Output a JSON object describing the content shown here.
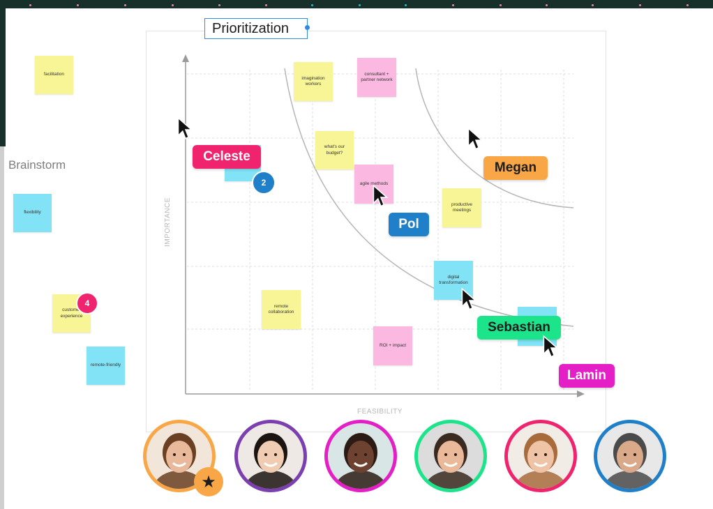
{
  "frame": {
    "title": "Prioritization"
  },
  "sidebar": {
    "label": "Brainstorm"
  },
  "axes": {
    "x_label": "FEASIBILITY",
    "y_label": "IMPORTANCE"
  },
  "colors": {
    "sticky_yellow": "#f8f596",
    "sticky_blue": "#82e3f7",
    "sticky_pink": "#fbb8e0",
    "celeste": "#f0236e",
    "megan": "#f8a646",
    "pol": "#1f7fc8",
    "sebastian": "#1be48a",
    "lamin": "#e41fc5",
    "selection": "#2f8ce0"
  },
  "notes": {
    "facilitation": "facilitation",
    "flexibility": "flexibility",
    "customer_experience": "customer experience",
    "remote_friendly": "remote-friendly",
    "imagination_workers": "imagination workers",
    "consultant_network": "consultant + partner network",
    "budget": "what's our budget?",
    "agile": "agile methods",
    "productive_meetings": "productive meetings",
    "digital_transformation": "digital transformation",
    "remote_collaboration": "remote collaboration",
    "roi": "ROI + impact"
  },
  "badges": {
    "celeste_count": "2",
    "customer_count": "4"
  },
  "collaborators": {
    "celeste": "Celeste",
    "megan": "Megan",
    "pol": "Pol",
    "sebastian": "Sebastian",
    "lamin": "Lamin"
  },
  "avatars": [
    {
      "name": "avatar-1",
      "ring": "#f8a646",
      "skin": "#e8b99a",
      "hair": "#6b3f22",
      "bg": "#f2e6da"
    },
    {
      "name": "avatar-2",
      "ring": "#7b3fb0",
      "skin": "#f0cdb2",
      "hair": "#1c1410",
      "bg": "#efe9e6"
    },
    {
      "name": "avatar-3",
      "ring": "#e41fc5",
      "skin": "#6e4230",
      "hair": "#2b1b14",
      "bg": "#d8e6e6"
    },
    {
      "name": "avatar-4",
      "ring": "#1be48a",
      "skin": "#e9b99a",
      "hair": "#3a2a20",
      "bg": "#dcdcdc"
    },
    {
      "name": "avatar-5",
      "ring": "#f0236e",
      "skin": "#eec3a6",
      "hair": "#a86c3c",
      "bg": "#f2ece6"
    },
    {
      "name": "avatar-6",
      "ring": "#1f7fc8",
      "skin": "#d9a98a",
      "hair": "#4a4a4a",
      "bg": "#e8e8e8"
    }
  ]
}
